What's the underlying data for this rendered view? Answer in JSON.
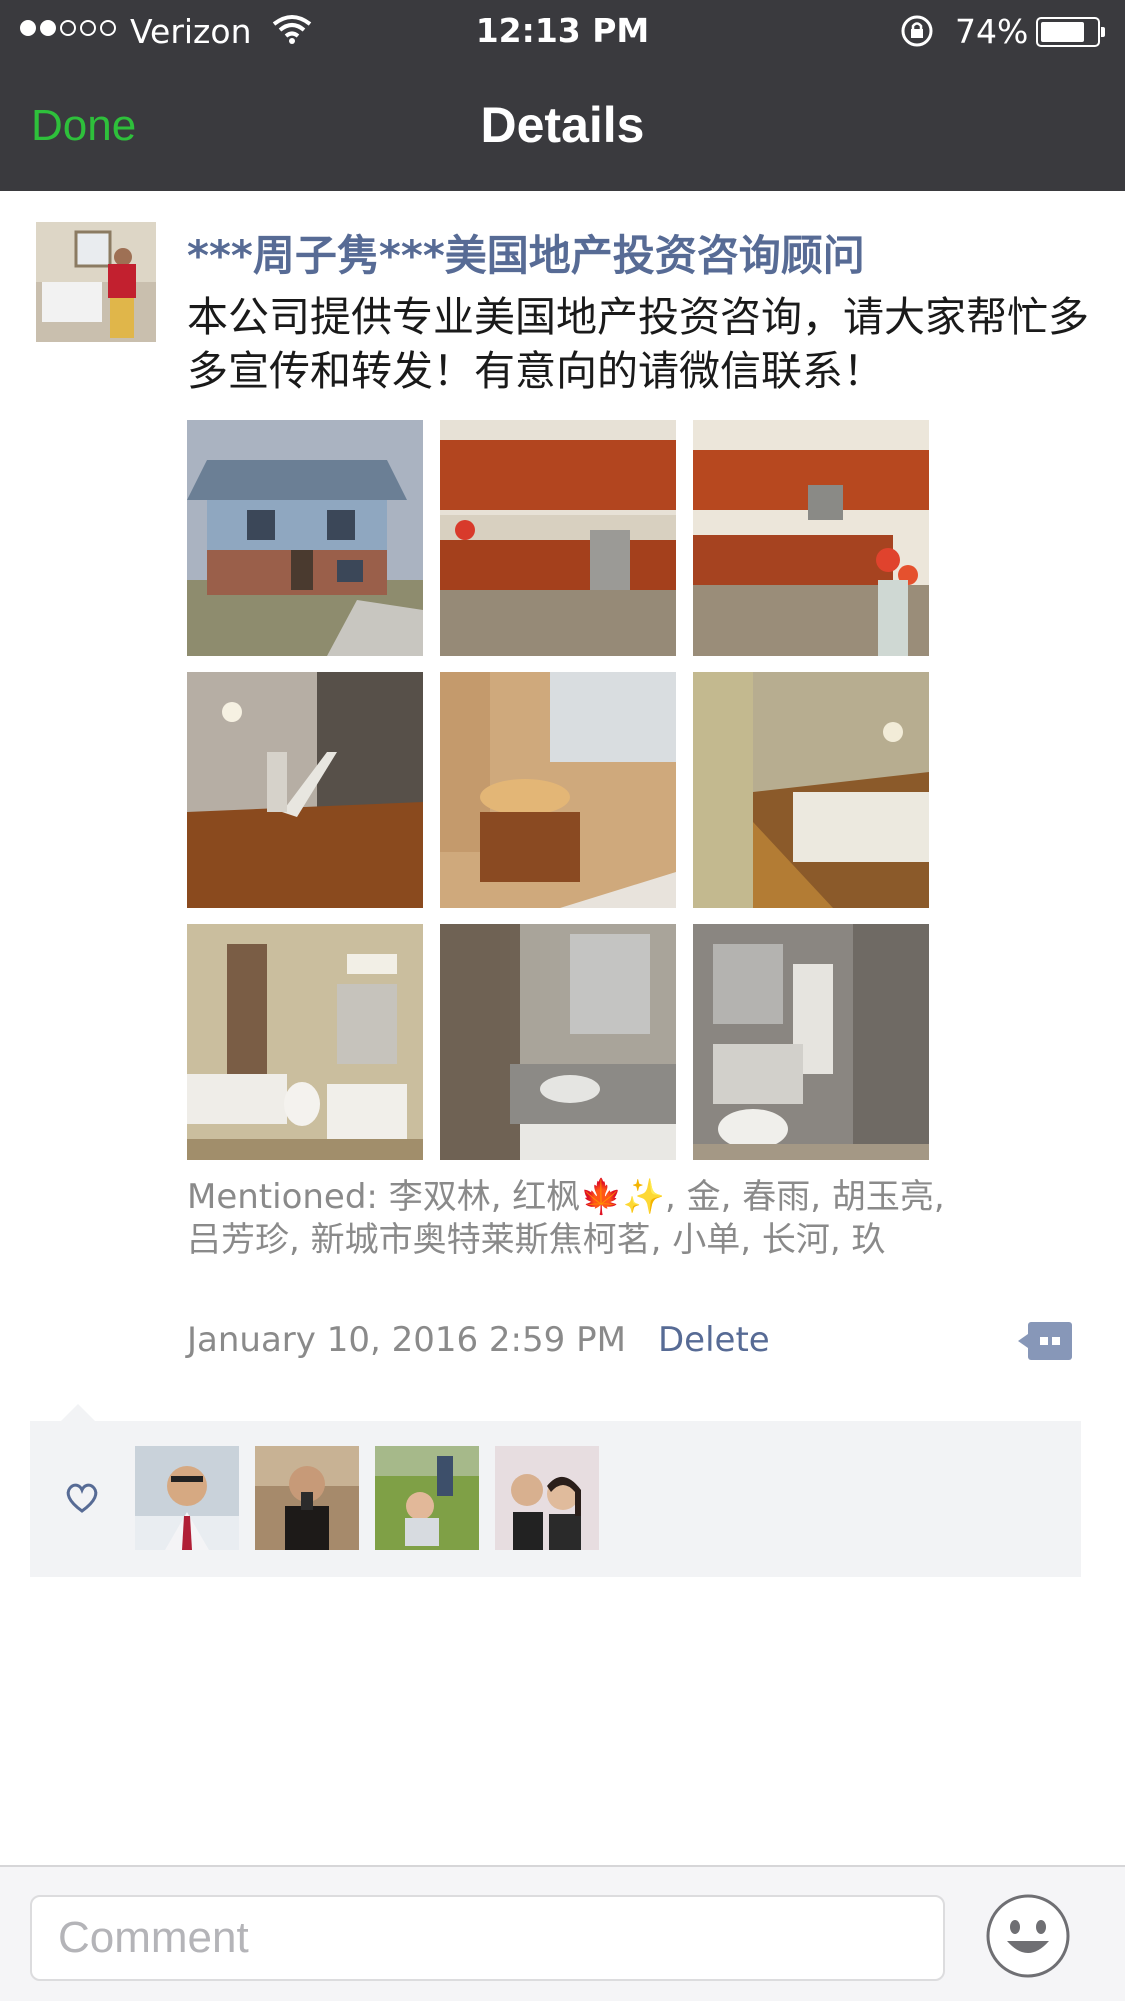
{
  "status_bar": {
    "carrier": "Verizon",
    "time": "12:13 PM",
    "battery": "74%",
    "battery_level": 0.74,
    "signal_bars": 2
  },
  "nav": {
    "done_label": "Done",
    "title": "Details"
  },
  "post": {
    "author": "***周子隽***美国地产投资咨询顾问",
    "text": "本公司提供专业美国地产投资咨询，请大家帮忙多多宣传和转发！有意向的请微信联系！",
    "photos": [
      "house-exterior",
      "kitchen",
      "kitchen-flowers",
      "living-room-stairs",
      "bathroom-vessel-sink",
      "hallway-stairs",
      "bathroom-tub",
      "bathroom-shower",
      "bathroom-double-vanity"
    ],
    "mentioned": "Mentioned: 李双林, 红枫🍁✨, 金, 春雨, 胡玉亮, 吕芳珍, 新城市奥特莱斯焦柯茗, 小单, 长河, 玖",
    "timestamp": "January 10, 2016 2:59 PM",
    "delete_label": "Delete"
  },
  "likes": {
    "avatars": [
      "liker-1",
      "liker-2",
      "liker-3",
      "liker-4"
    ]
  },
  "comment_bar": {
    "placeholder": "Comment"
  },
  "colors": {
    "nav_bg": "#3a3a3e",
    "done_green": "#2ec03b",
    "link_blue": "#576b95",
    "meta_gray": "#8a8a8a",
    "likes_bg": "#f2f3f5"
  }
}
